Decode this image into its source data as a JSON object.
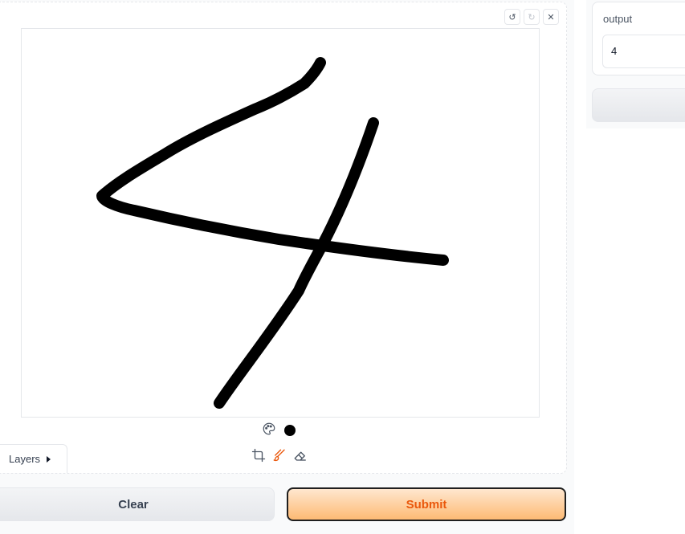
{
  "sketchpad": {
    "toolbar_icons": [
      "undo-icon",
      "redo-icon",
      "close-icon"
    ],
    "undo_glyph": "↺",
    "redo_glyph": "↻",
    "close_glyph": "✕",
    "brush_color": "#000000",
    "accent_color": "#ea580c",
    "layers_label": "Layers"
  },
  "actions": {
    "clear_label": "Clear",
    "submit_label": "Submit"
  },
  "output": {
    "label": "output",
    "value": "4"
  }
}
